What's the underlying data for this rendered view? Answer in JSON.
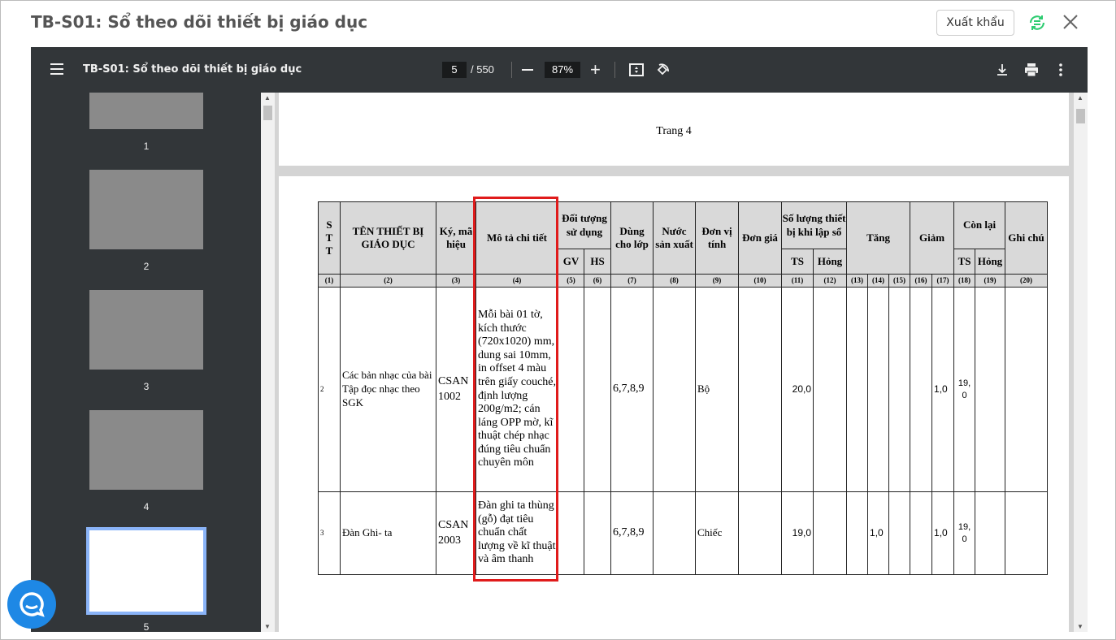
{
  "dialog": {
    "title": "TB-S01: Sổ theo dõi thiết bị giáo dục",
    "export_label": "Xuất khẩu"
  },
  "toolbar": {
    "title": "TB-S01: Sổ theo dõi thiết bị giáo dục",
    "page": "5",
    "total": "/ 550",
    "zoom": "87%"
  },
  "thumbnails": [
    "1",
    "2",
    "3",
    "4",
    "5"
  ],
  "page_footer": "Trang 4",
  "table": {
    "headers": {
      "stt": "STT",
      "ten": "TÊN THIẾT BỊ GIÁO DỤC",
      "ky": "Ký, mã hiệu",
      "mota": "Mô tả chi tiết",
      "doituong": "Đối tượng sử dụng",
      "gv": "GV",
      "hs": "HS",
      "dung": "Dùng cho lớp",
      "nuoc": "Nước sản xuất",
      "donvi": "Đơn vị tính",
      "dongia": "Đơn giá",
      "soluong": "Số lượng thiết bị khi lập sổ",
      "ts": "TS",
      "hong": "Hỏng",
      "tang": "Tăng",
      "giam": "Giảm",
      "conlai": "Còn lại",
      "ts2": "TS",
      "hong2": "Hỏng",
      "ghichu": "Ghi chú"
    },
    "col_numbers": [
      "(1)",
      "(2)",
      "(3)",
      "(4)",
      "(5)",
      "(6)",
      "(7)",
      "(8)",
      "(9)",
      "(10)",
      "(11)",
      "(12)",
      "(13)",
      "(14)",
      "(15)",
      "(16)",
      "(17)",
      "(18)",
      "(19)",
      "(20)"
    ],
    "rows": [
      {
        "stt": "2",
        "ten": "Các bản nhạc của bài Tập đọc nhạc theo SGK",
        "ky": "CSAN 1002",
        "mota": "Mỗi bài 01 tờ, kích thước (720x1020) mm, dung sai 10mm, in offset 4 màu trên giấy couché, định lượng 200g/m2; cán láng OPP mờ, kĩ thuật chép nhạc đúng tiêu chuẩn chuyên môn",
        "lop": "6,7,8,9",
        "donvi": "Bộ",
        "ts": "20,0",
        "c14": "",
        "c17": "1,0",
        "c18": "19, 0"
      },
      {
        "stt": "3",
        "ten": "Đàn Ghi- ta",
        "ky": "CSAN 2003",
        "mota": "Đàn ghi ta thùng (gỗ) đạt tiêu chuẩn chất lượng về kĩ thuật và âm thanh",
        "lop": "6,7,8,9",
        "donvi": "Chiếc",
        "ts": "19,0",
        "c14": "1,0",
        "c17": "1,0",
        "c18": "19, 0"
      }
    ]
  },
  "colors": {
    "highlight": "#e01b1b",
    "toolbar": "#323639",
    "accent": "#1e88e5",
    "sync": "#2ecc71"
  }
}
